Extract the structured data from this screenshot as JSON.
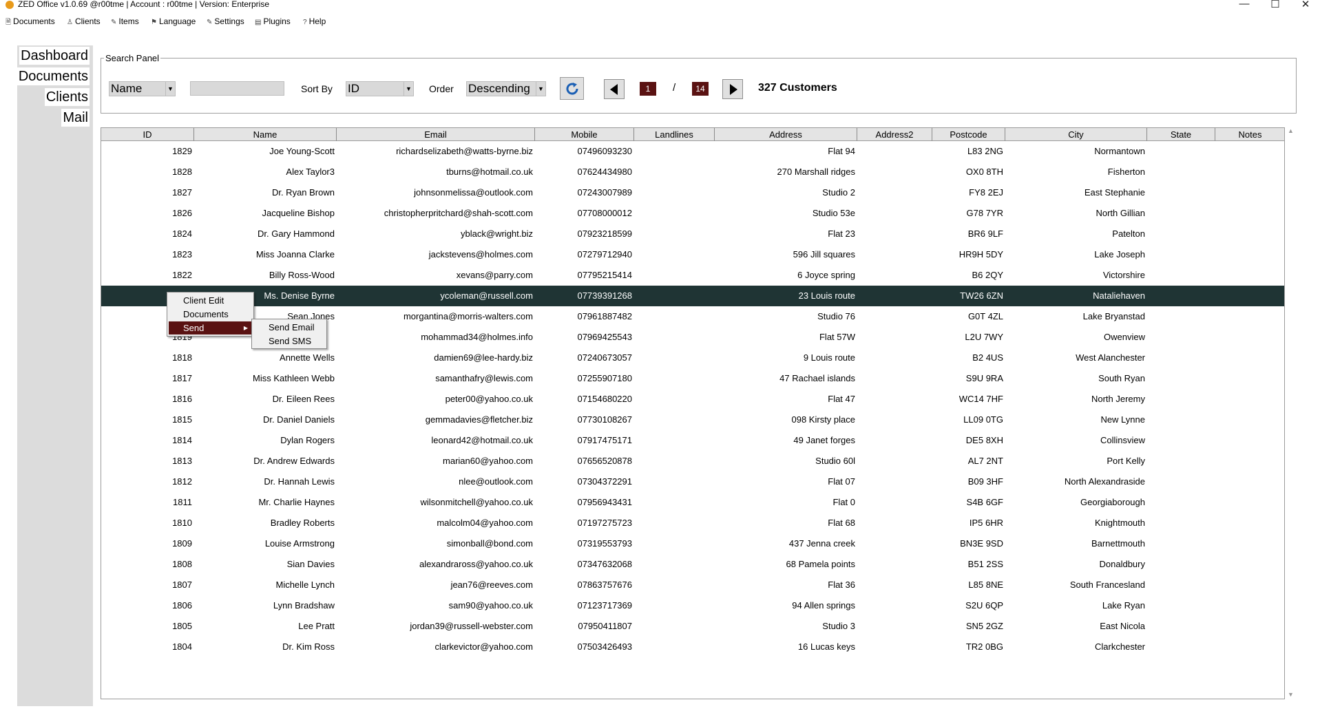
{
  "window": {
    "title": "ZED Office  v1.0.69 @r00tme  | Account : r00tme | Version: Enterprise",
    "minimize_glyph": "—",
    "maximize_glyph": "☐",
    "close_glyph": "✕"
  },
  "menu": [
    {
      "label": "Documents",
      "icon": "document-icon",
      "glyph": "🗎"
    },
    {
      "label": "Clients",
      "icon": "user-icon",
      "glyph": "♙"
    },
    {
      "label": "Items",
      "icon": "pencil-icon",
      "glyph": "✎"
    },
    {
      "label": "Language",
      "icon": "flag-icon",
      "glyph": "⚑"
    },
    {
      "label": "Settings",
      "icon": "wrench-icon",
      "glyph": "✎"
    },
    {
      "label": "Plugins",
      "icon": "plugin-icon",
      "glyph": "▤"
    },
    {
      "label": "Help",
      "icon": "help-icon",
      "glyph": "?"
    }
  ],
  "sidebar": {
    "items": [
      {
        "label": "Dashboard"
      },
      {
        "label": "Documents"
      },
      {
        "label": "Clients"
      },
      {
        "label": "Mail"
      }
    ]
  },
  "search_panel": {
    "legend": "Search Panel",
    "field_combo": "Name",
    "search_value": "",
    "sort_by_label": "Sort By",
    "sort_by_value": "ID",
    "order_label": "Order",
    "order_value": "Descending",
    "page_current": "1",
    "page_separator": "/",
    "page_total": "14",
    "customer_count": "327 Customers"
  },
  "table": {
    "columns": [
      "ID",
      "Name",
      "Email",
      "Mobile",
      "Landlines",
      "Address",
      "Address2",
      "Postcode",
      "City",
      "State",
      "Notes"
    ],
    "selected_index": 7,
    "rows": [
      [
        "1829",
        "Joe Young-Scott",
        "richardselizabeth@watts-byrne.biz",
        "07496093230",
        "",
        "Flat 94",
        "",
        "L83 2NG",
        "Normantown",
        "",
        ""
      ],
      [
        "1828",
        "Alex Taylor3",
        "tburns@hotmail.co.uk",
        "07624434980",
        "",
        "270 Marshall ridges",
        "",
        "OX0 8TH",
        "Fisherton",
        "",
        ""
      ],
      [
        "1827",
        "Dr. Ryan Brown",
        "johnsonmelissa@outlook.com",
        "07243007989",
        "",
        "Studio 2",
        "",
        "FY8 2EJ",
        "East Stephanie",
        "",
        ""
      ],
      [
        "1826",
        "Jacqueline Bishop",
        "christopherpritchard@shah-scott.com",
        "07708000012",
        "",
        "Studio 53e",
        "",
        "G78 7YR",
        "North Gillian",
        "",
        ""
      ],
      [
        "1824",
        "Dr. Gary Hammond",
        "yblack@wright.biz",
        "07923218599",
        "",
        "Flat 23",
        "",
        "BR6 9LF",
        "Patelton",
        "",
        ""
      ],
      [
        "1823",
        "Miss Joanna Clarke",
        "jackstevens@holmes.com",
        "07279712940",
        "",
        "596 Jill squares",
        "",
        "HR9H 5DY",
        "Lake Joseph",
        "",
        ""
      ],
      [
        "1822",
        "Billy Ross-Wood",
        "xevans@parry.com",
        "07795215414",
        "",
        "6 Joyce spring",
        "",
        "B6 2QY",
        "Victorshire",
        "",
        ""
      ],
      [
        "",
        "Ms. Denise Byrne",
        "ycoleman@russell.com",
        "07739391268",
        "",
        "23 Louis route",
        "",
        "TW26 6ZN",
        "Nataliehaven",
        "",
        ""
      ],
      [
        "",
        "Sean Jones",
        "morgantina@morris-walters.com",
        "07961887482",
        "",
        "Studio 76",
        "",
        "G0T 4ZL",
        "Lake Bryanstad",
        "",
        ""
      ],
      [
        "1819",
        "",
        "mohammad34@holmes.info",
        "07969425543",
        "",
        "Flat 57W",
        "",
        "L2U 7WY",
        "Owenview",
        "",
        ""
      ],
      [
        "1818",
        "Annette Wells",
        "damien69@lee-hardy.biz",
        "07240673057",
        "",
        "9 Louis route",
        "",
        "B2 4US",
        "West Alanchester",
        "",
        ""
      ],
      [
        "1817",
        "Miss Kathleen Webb",
        "samanthafry@lewis.com",
        "07255907180",
        "",
        "47 Rachael islands",
        "",
        "S9U 9RA",
        "South Ryan",
        "",
        ""
      ],
      [
        "1816",
        "Dr. Eileen Rees",
        "peter00@yahoo.co.uk",
        "07154680220",
        "",
        "Flat 47",
        "",
        "WC14 7HF",
        "North Jeremy",
        "",
        ""
      ],
      [
        "1815",
        "Dr. Daniel Daniels",
        "gemmadavies@fletcher.biz",
        "07730108267",
        "",
        "098 Kirsty place",
        "",
        "LL09 0TG",
        "New Lynne",
        "",
        ""
      ],
      [
        "1814",
        "Dylan Rogers",
        "leonard42@hotmail.co.uk",
        "07917475171",
        "",
        "49 Janet forges",
        "",
        "DE5 8XH",
        "Collinsview",
        "",
        ""
      ],
      [
        "1813",
        "Dr. Andrew Edwards",
        "marian60@yahoo.com",
        "07656520878",
        "",
        "Studio 60l",
        "",
        "AL7 2NT",
        "Port Kelly",
        "",
        ""
      ],
      [
        "1812",
        "Dr. Hannah Lewis",
        "nlee@outlook.com",
        "07304372291",
        "",
        "Flat 07",
        "",
        "B09 3HF",
        "North Alexandraside",
        "",
        ""
      ],
      [
        "1811",
        "Mr. Charlie Haynes",
        "wilsonmitchell@yahoo.co.uk",
        "07956943431",
        "",
        "Flat 0",
        "",
        "S4B 6GF",
        "Georgiaborough",
        "",
        ""
      ],
      [
        "1810",
        "Bradley Roberts",
        "malcolm04@yahoo.com",
        "07197275723",
        "",
        "Flat 68",
        "",
        "IP5 6HR",
        "Knightmouth",
        "",
        ""
      ],
      [
        "1809",
        "Louise Armstrong",
        "simonball@bond.com",
        "07319553793",
        "",
        "437 Jenna creek",
        "",
        "BN3E 9SD",
        "Barnettmouth",
        "",
        ""
      ],
      [
        "1808",
        "Sian Davies",
        "alexandraross@yahoo.co.uk",
        "07347632068",
        "",
        "68 Pamela points",
        "",
        "B51 2SS",
        "Donaldbury",
        "",
        ""
      ],
      [
        "1807",
        "Michelle Lynch",
        "jean76@reeves.com",
        "07863757676",
        "",
        "Flat 36",
        "",
        "L85 8NE",
        "South Francesland",
        "",
        ""
      ],
      [
        "1806",
        "Lynn Bradshaw",
        "sam90@yahoo.co.uk",
        "07123717369",
        "",
        "94 Allen springs",
        "",
        "S2U 6QP",
        "Lake Ryan",
        "",
        ""
      ],
      [
        "1805",
        "Lee Pratt",
        "jordan39@russell-webster.com",
        "07950411807",
        "",
        "Studio 3",
        "",
        "SN5 2GZ",
        "East Nicola",
        "",
        ""
      ],
      [
        "1804",
        "Dr. Kim Ross",
        "clarkevictor@yahoo.com",
        "07503426493",
        "",
        "16 Lucas keys",
        "",
        "TR2 0BG",
        "Clarkchester",
        "",
        ""
      ]
    ]
  },
  "context_menu": {
    "items": [
      "Client Edit",
      "Documents",
      "Send"
    ],
    "submenu_arrow": "▶",
    "send_submenu": [
      "Send Email",
      "Send SMS"
    ]
  },
  "colors": {
    "selected_row": "#1f3434",
    "accent": "#5a1212",
    "refresh_icon": "#1a5fb4"
  }
}
